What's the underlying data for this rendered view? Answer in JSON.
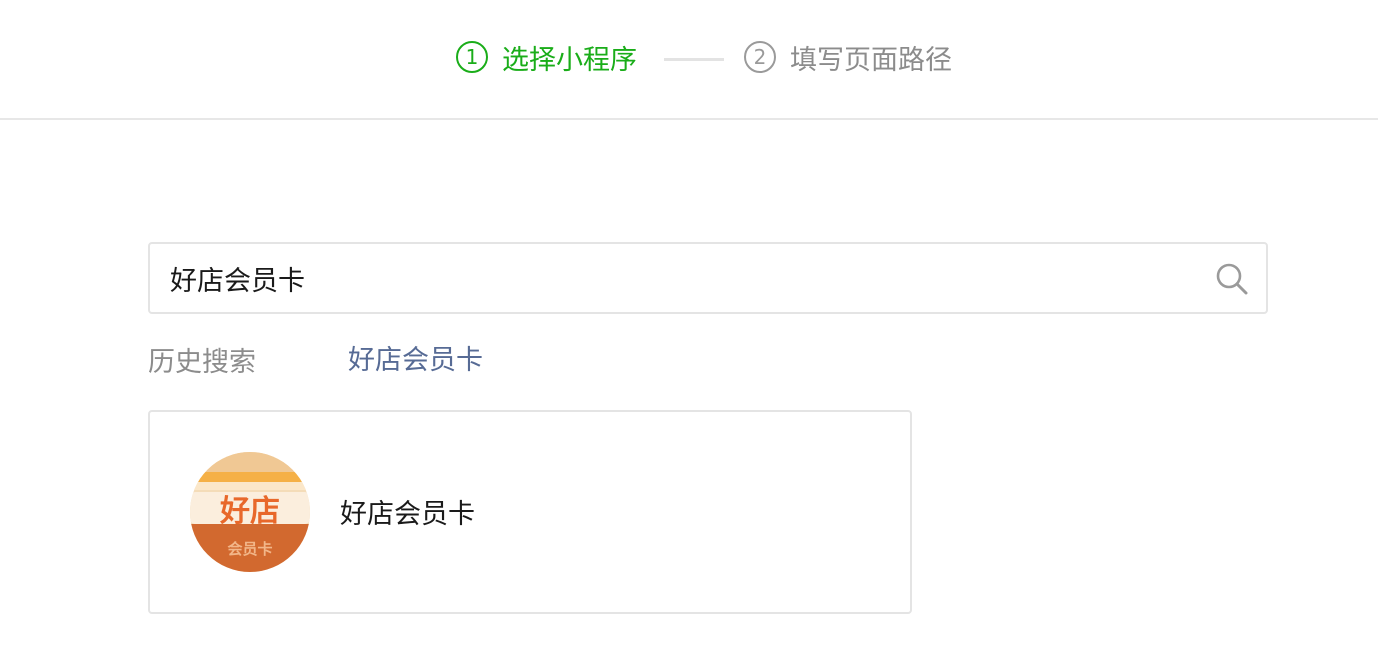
{
  "steps": {
    "step1": {
      "number": "1",
      "label": "选择小程序"
    },
    "step2": {
      "number": "2",
      "label": "填写页面路径"
    }
  },
  "colors": {
    "active": "#1aad19",
    "inactive": "#8c8c8c",
    "link": "#576b95"
  },
  "search": {
    "value": "好店会员卡",
    "icon": "search-icon"
  },
  "history": {
    "label": "历史搜索",
    "items": [
      "好店会员卡"
    ]
  },
  "results": [
    {
      "name": "好店会员卡",
      "logo": {
        "main_text": "好店",
        "sub_text": "会员卡"
      }
    }
  ]
}
